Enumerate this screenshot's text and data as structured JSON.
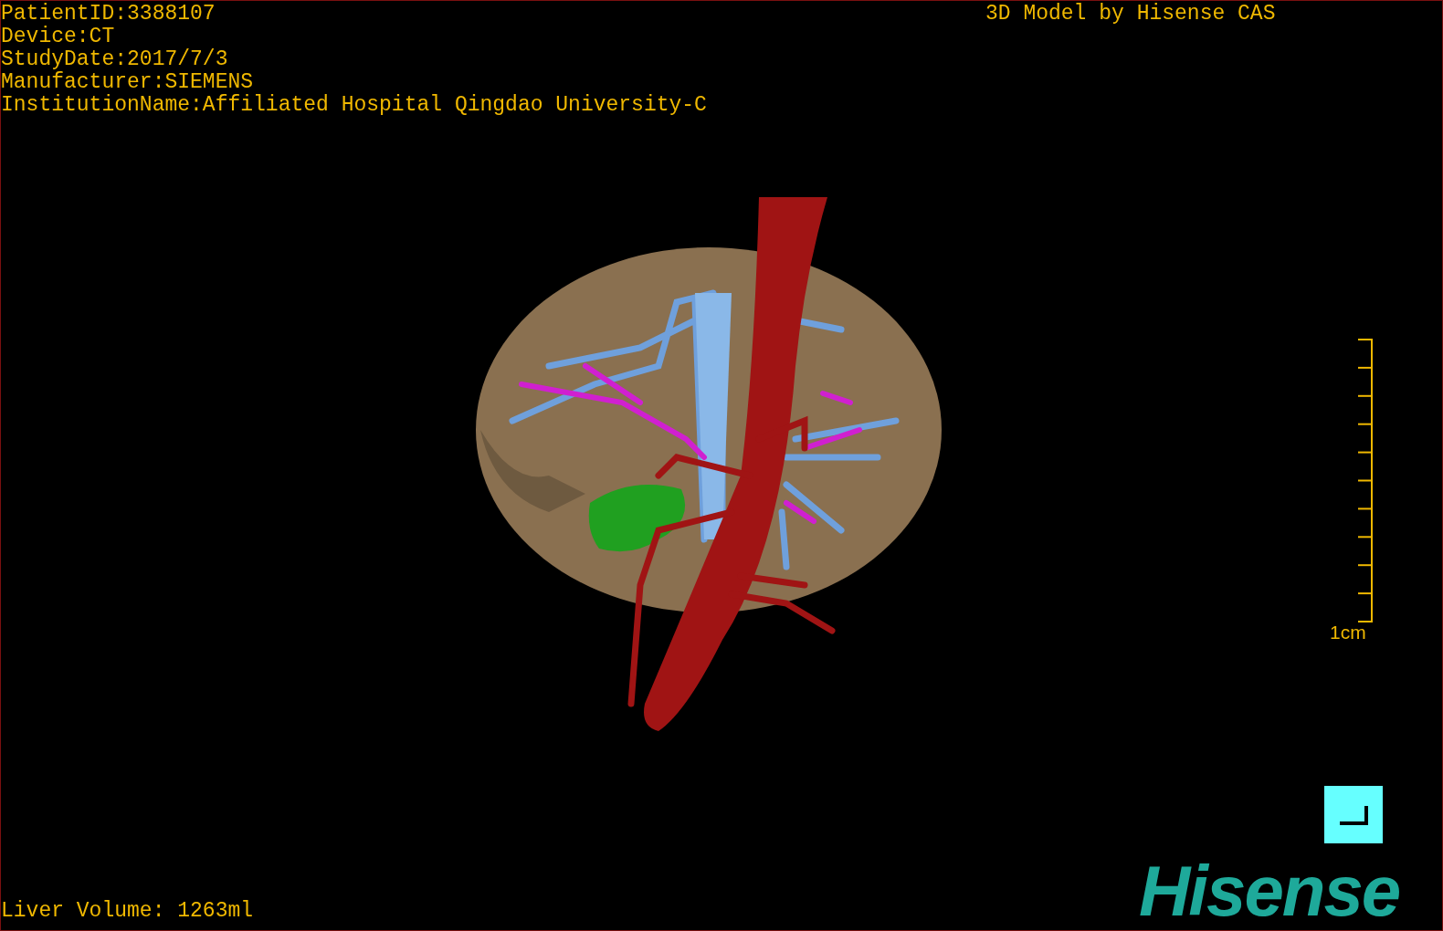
{
  "patient_info": [
    "PatientID:3388107",
    "Device:CT",
    "StudyDate:2017/7/3",
    "Manufacturer:SIEMENS",
    "InstitutionName:Affiliated Hospital Qingdao University-C"
  ],
  "model_credit": "3D Model by Hisense CAS",
  "scale_bar": {
    "label": "1cm"
  },
  "liver_volume": "Liver Volume: 1263ml",
  "logo": "Hisense"
}
